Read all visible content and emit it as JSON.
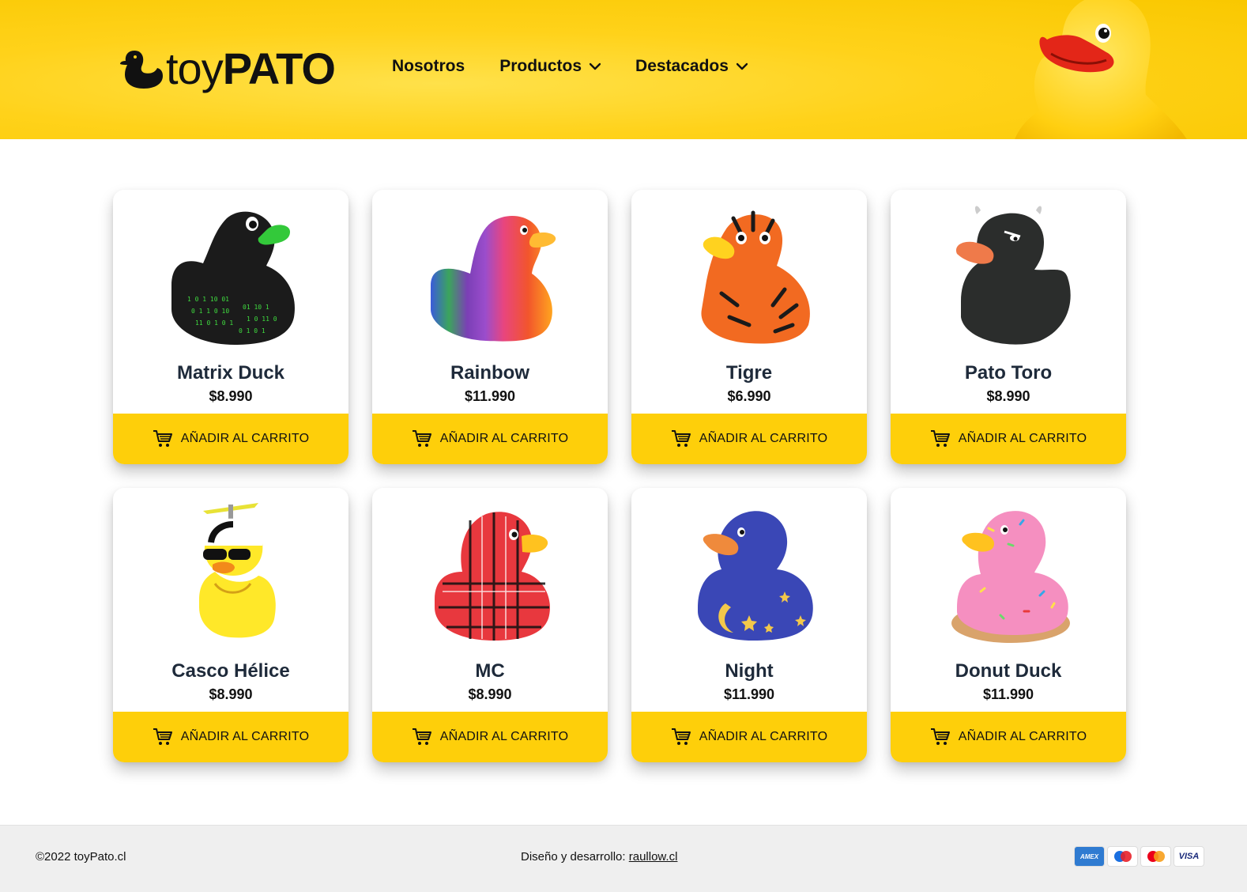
{
  "brand": {
    "name_thin": "toy",
    "name_bold": "PATO"
  },
  "nav": {
    "items": [
      {
        "label": "Nosotros",
        "dropdown": false
      },
      {
        "label": "Productos",
        "dropdown": true
      },
      {
        "label": "Destacados",
        "dropdown": true
      }
    ]
  },
  "products": [
    {
      "name": "Matrix Duck",
      "price": "$8.990",
      "button": "AÑADIR AL CARRITO",
      "body_color": "#1b1b1b",
      "beak_color": "#33c93a"
    },
    {
      "name": "Rainbow",
      "price": "$11.990",
      "button": "AÑADIR AL CARRITO",
      "body_color": "#e0457b",
      "beak_color": "#ffbb33"
    },
    {
      "name": "Tigre",
      "price": "$6.990",
      "button": "AÑADIR AL CARRITO",
      "body_color": "#f26a21",
      "beak_color": "#ffd21f"
    },
    {
      "name": "Pato Toro",
      "price": "$8.990",
      "button": "AÑADIR AL CARRITO",
      "body_color": "#2b2d2c",
      "beak_color": "#ef7a4a"
    },
    {
      "name": "Casco Hélice",
      "price": "$8.990",
      "button": "AÑADIR AL CARRITO",
      "body_color": "#ffe829",
      "beak_color": "#f28a1a"
    },
    {
      "name": "MC",
      "price": "$8.990",
      "button": "AÑADIR AL CARRITO",
      "body_color": "#e8383e",
      "beak_color": "#ffc21f"
    },
    {
      "name": "Night",
      "price": "$11.990",
      "button": "AÑADIR AL CARRITO",
      "body_color": "#3a47b6",
      "beak_color": "#ef8a3c"
    },
    {
      "name": "Donut Duck",
      "price": "$11.990",
      "button": "AÑADIR AL CARRITO",
      "body_color": "#f58fc0",
      "beak_color": "#ffc21f"
    }
  ],
  "footer": {
    "copyright": "©2022 toyPato.cl",
    "design_prefix": "Diseño y desarrollo: ",
    "design_link": "raullow.cl",
    "payments": [
      "AMEX",
      "maestro",
      "mastercard",
      "VISA"
    ]
  },
  "colors": {
    "header_yellow": "#ffd21a",
    "button_yellow": "#fecf0a",
    "footer_bg": "#efefef"
  }
}
